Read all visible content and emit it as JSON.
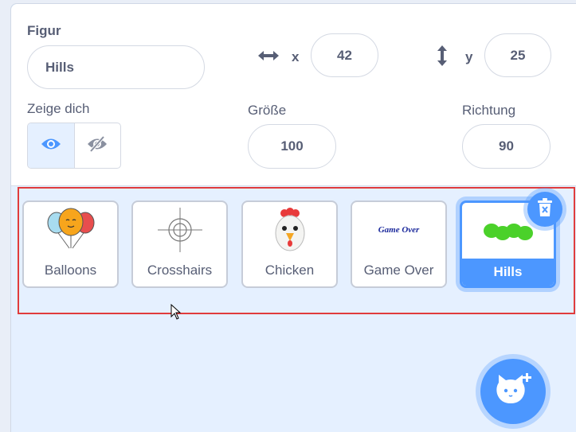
{
  "sprite_info": {
    "sprite_label": "Figur",
    "sprite_name": "Hills",
    "x_label": "x",
    "x_value": "42",
    "y_label": "y",
    "y_value": "25",
    "show_label": "Zeige dich",
    "size_label": "Größe",
    "size_value": "100",
    "direction_label": "Richtung",
    "direction_value": "90"
  },
  "sprites": [
    {
      "name": "Balloons",
      "icon": "balloons-icon",
      "selected": false
    },
    {
      "name": "Crosshairs",
      "icon": "crosshairs-icon",
      "selected": false
    },
    {
      "name": "Chicken",
      "icon": "chicken-icon",
      "selected": false
    },
    {
      "name": "Game Over",
      "icon": "game-over-icon",
      "thumb_text": "Game Over",
      "selected": false
    },
    {
      "name": "Hills",
      "icon": "hills-icon",
      "selected": true
    }
  ],
  "colors": {
    "accent": "#4c97ff",
    "text": "#575e75",
    "highlight_box": "#e03c3c",
    "panel_bg": "#e5f0ff"
  },
  "icons": [
    "x-arrows-icon",
    "y-arrows-icon",
    "eye-icon",
    "eye-slash-icon",
    "trash-icon",
    "add-sprite-cat-icon",
    "mouse-cursor-icon"
  ]
}
